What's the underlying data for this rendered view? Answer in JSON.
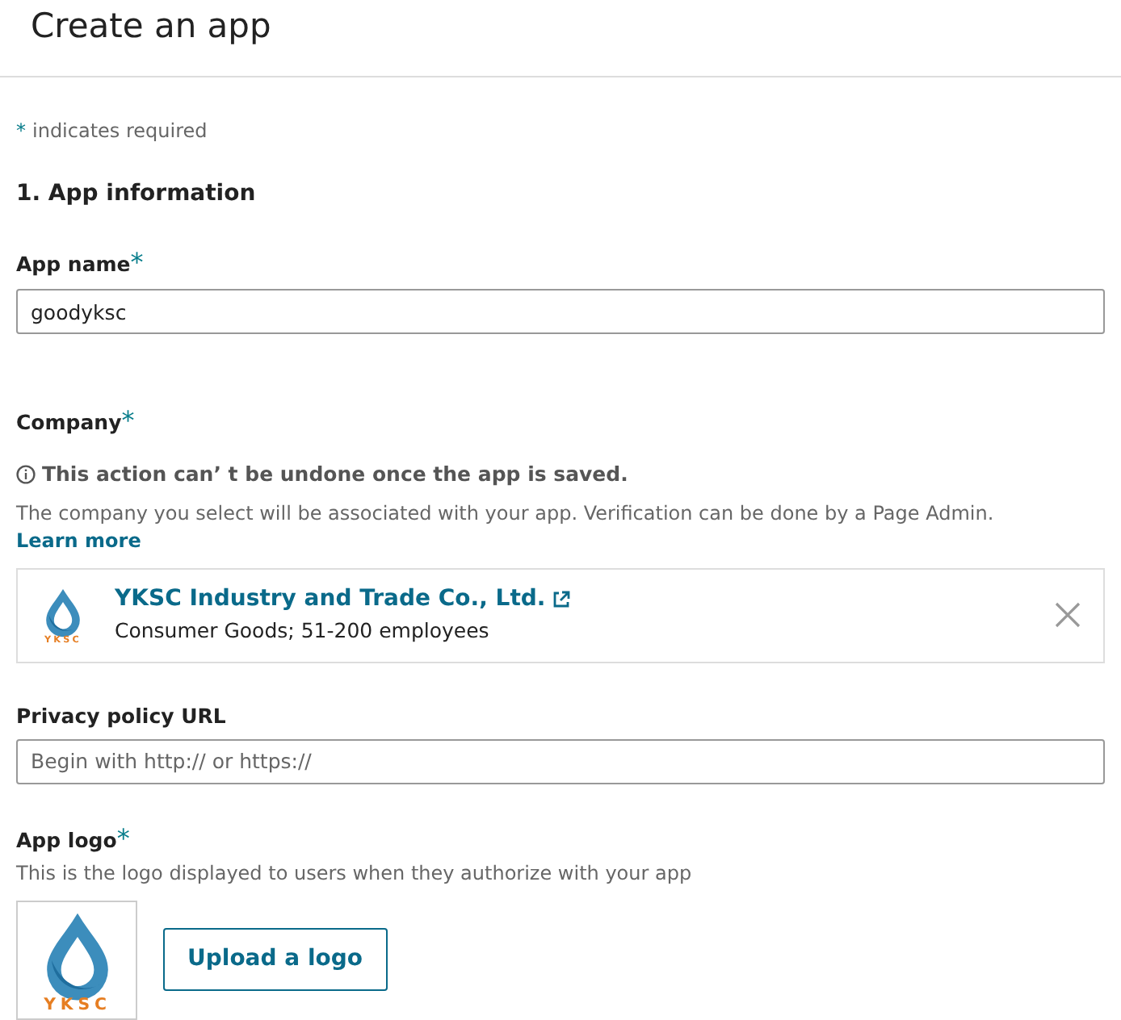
{
  "page_title": "Create an app",
  "required_note": {
    "mark": "*",
    "text": "indicates required"
  },
  "section_title": "1. App information",
  "app_name": {
    "label": "App name",
    "required_mark": "*",
    "value": "goodyksc"
  },
  "company": {
    "label": "Company",
    "required_mark": "*",
    "warning": "This action can’ t be undone once the app is saved.",
    "description": "The company you select will be associated with your app. Verification can be done by a Page Admin.",
    "link": "Learn more",
    "selected": {
      "logo_text": "YKSC",
      "name": "Industry and Trade Co., Ltd.",
      "name_prefix": "YKSC",
      "details": "Consumer Goods; 51-200 employees"
    }
  },
  "privacy_policy": {
    "label": "Privacy policy URL",
    "placeholder": "Begin with http:// or https://"
  },
  "app_logo": {
    "label": "App logo",
    "required_mark": "*",
    "help": "This is the logo displayed to users when they authorize with your app",
    "logo_text": "YKSC",
    "button": "Upload a logo"
  }
}
